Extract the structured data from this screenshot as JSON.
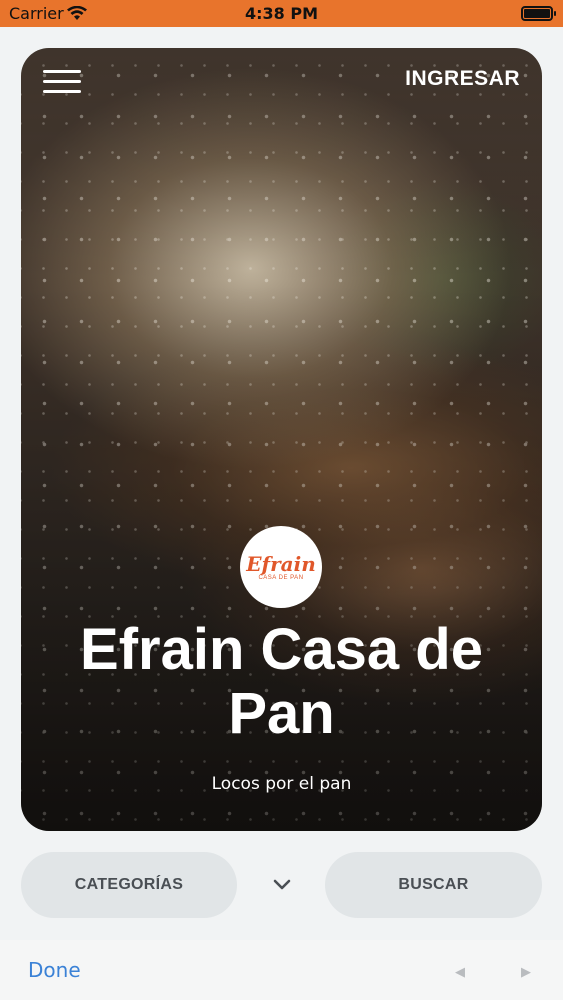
{
  "status_bar": {
    "carrier": "Carrier",
    "time": "4:38 PM",
    "icons": [
      "wifi-icon",
      "battery-icon"
    ]
  },
  "header": {
    "menu_icon": "hamburger-menu-icon",
    "login_label": "INGRESAR"
  },
  "hero": {
    "logo_text": "Efrain",
    "logo_subtext": "CASA DE PAN",
    "title": "Efrain Casa de Pan",
    "subtitle": "Locos por el pan"
  },
  "actions": {
    "categories_label": "CATEGORÍAS",
    "search_label": "BUSCAR",
    "dropdown_icon": "chevron-down-icon"
  },
  "keyboard_accessory": {
    "done_label": "Done",
    "prev_icon": "◀",
    "next_icon": "▶"
  },
  "colors": {
    "status_bar_bg": "#e8742c",
    "brand_accent": "#e0572a",
    "done_link": "#3b82d6",
    "pill_bg": "#e1e5e7"
  }
}
